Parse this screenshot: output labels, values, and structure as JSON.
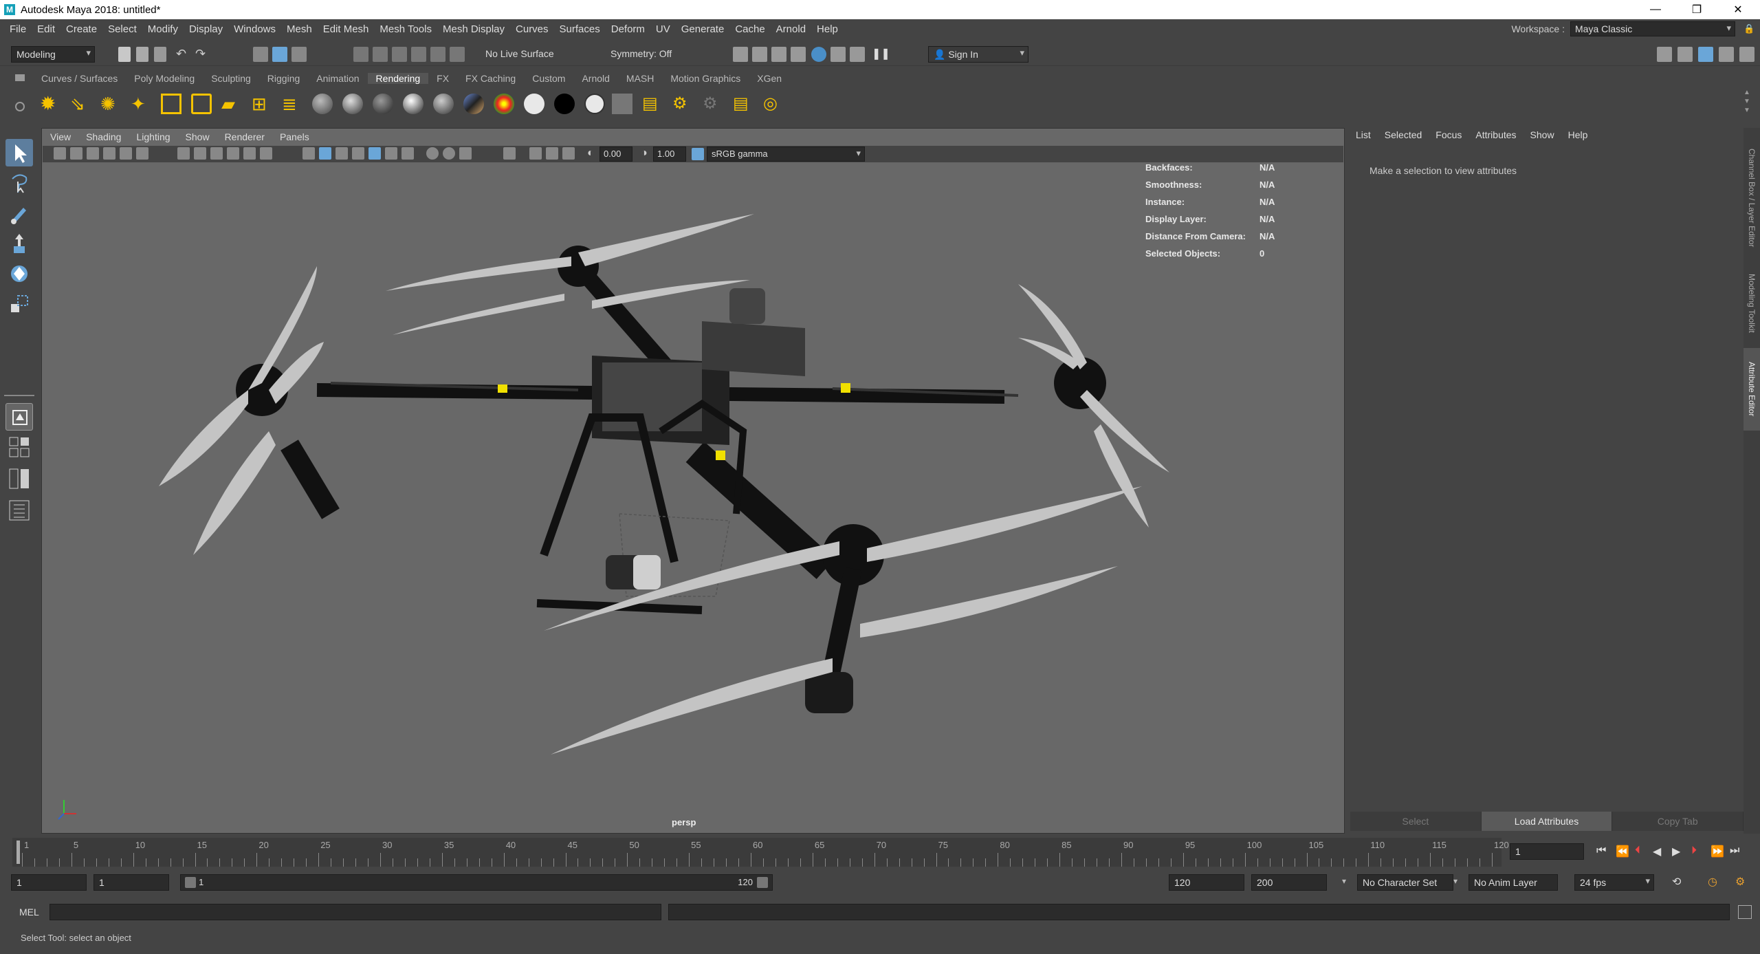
{
  "window": {
    "title": "Autodesk Maya 2018: untitled*",
    "logo": "M"
  },
  "menubar": [
    "File",
    "Edit",
    "Create",
    "Select",
    "Modify",
    "Display",
    "Windows",
    "Mesh",
    "Edit Mesh",
    "Mesh Tools",
    "Mesh Display",
    "Curves",
    "Surfaces",
    "Deform",
    "UV",
    "Generate",
    "Cache",
    "Arnold",
    "Help"
  ],
  "workspace": {
    "label": "Workspace :",
    "value": "Maya Classic"
  },
  "statusline": {
    "mode": "Modeling",
    "live_surface": "No Live Surface",
    "symmetry": "Symmetry: Off",
    "sign_in": "Sign In"
  },
  "shelf": {
    "tabs": [
      "Curves / Surfaces",
      "Poly Modeling",
      "Sculpting",
      "Rigging",
      "Animation",
      "Rendering",
      "FX",
      "FX Caching",
      "Custom",
      "Arnold",
      "MASH",
      "Motion Graphics",
      "XGen"
    ],
    "active": "Rendering"
  },
  "viewport": {
    "menu": [
      "View",
      "Shading",
      "Lighting",
      "Show",
      "Renderer",
      "Panels"
    ],
    "exposure": "0.00",
    "gamma": "1.00",
    "color_space": "sRGB gamma",
    "camera": "persp",
    "hud": [
      {
        "label": "Backfaces:",
        "value": "N/A"
      },
      {
        "label": "Smoothness:",
        "value": "N/A"
      },
      {
        "label": "Instance:",
        "value": "N/A"
      },
      {
        "label": "Display Layer:",
        "value": "N/A"
      },
      {
        "label": "Distance From Camera:",
        "value": "N/A"
      },
      {
        "label": "Selected Objects:",
        "value": "0"
      }
    ]
  },
  "attribute_editor": {
    "menu": [
      "List",
      "Selected",
      "Focus",
      "Attributes",
      "Show",
      "Help"
    ],
    "message": "Make a selection to view attributes",
    "buttons": [
      "Select",
      "Load Attributes",
      "Copy Tab"
    ]
  },
  "side_tabs": [
    "Channel Box / Layer Editor",
    "Modeling Toolkit",
    "Attribute Editor"
  ],
  "timeline": {
    "ticks": [
      "1",
      "5",
      "10",
      "15",
      "20",
      "25",
      "30",
      "35",
      "40",
      "45",
      "50",
      "55",
      "60",
      "65",
      "70",
      "75",
      "80",
      "85",
      "90",
      "95",
      "100",
      "105",
      "110",
      "115",
      "120"
    ],
    "current_frame": "1"
  },
  "range": {
    "start": "1",
    "playback_start": "1",
    "slider_start": "1",
    "slider_end": "120",
    "playback_end": "120",
    "end": "200",
    "character_set": "No Character Set",
    "anim_layer": "No Anim Layer",
    "fps": "24 fps"
  },
  "command": {
    "label": "MEL"
  },
  "help_line": "Select Tool: select an object",
  "colors": {
    "accent": "#6aa6d8",
    "viewport_bg": "#686868",
    "maya_logo": "#15a0b8"
  }
}
